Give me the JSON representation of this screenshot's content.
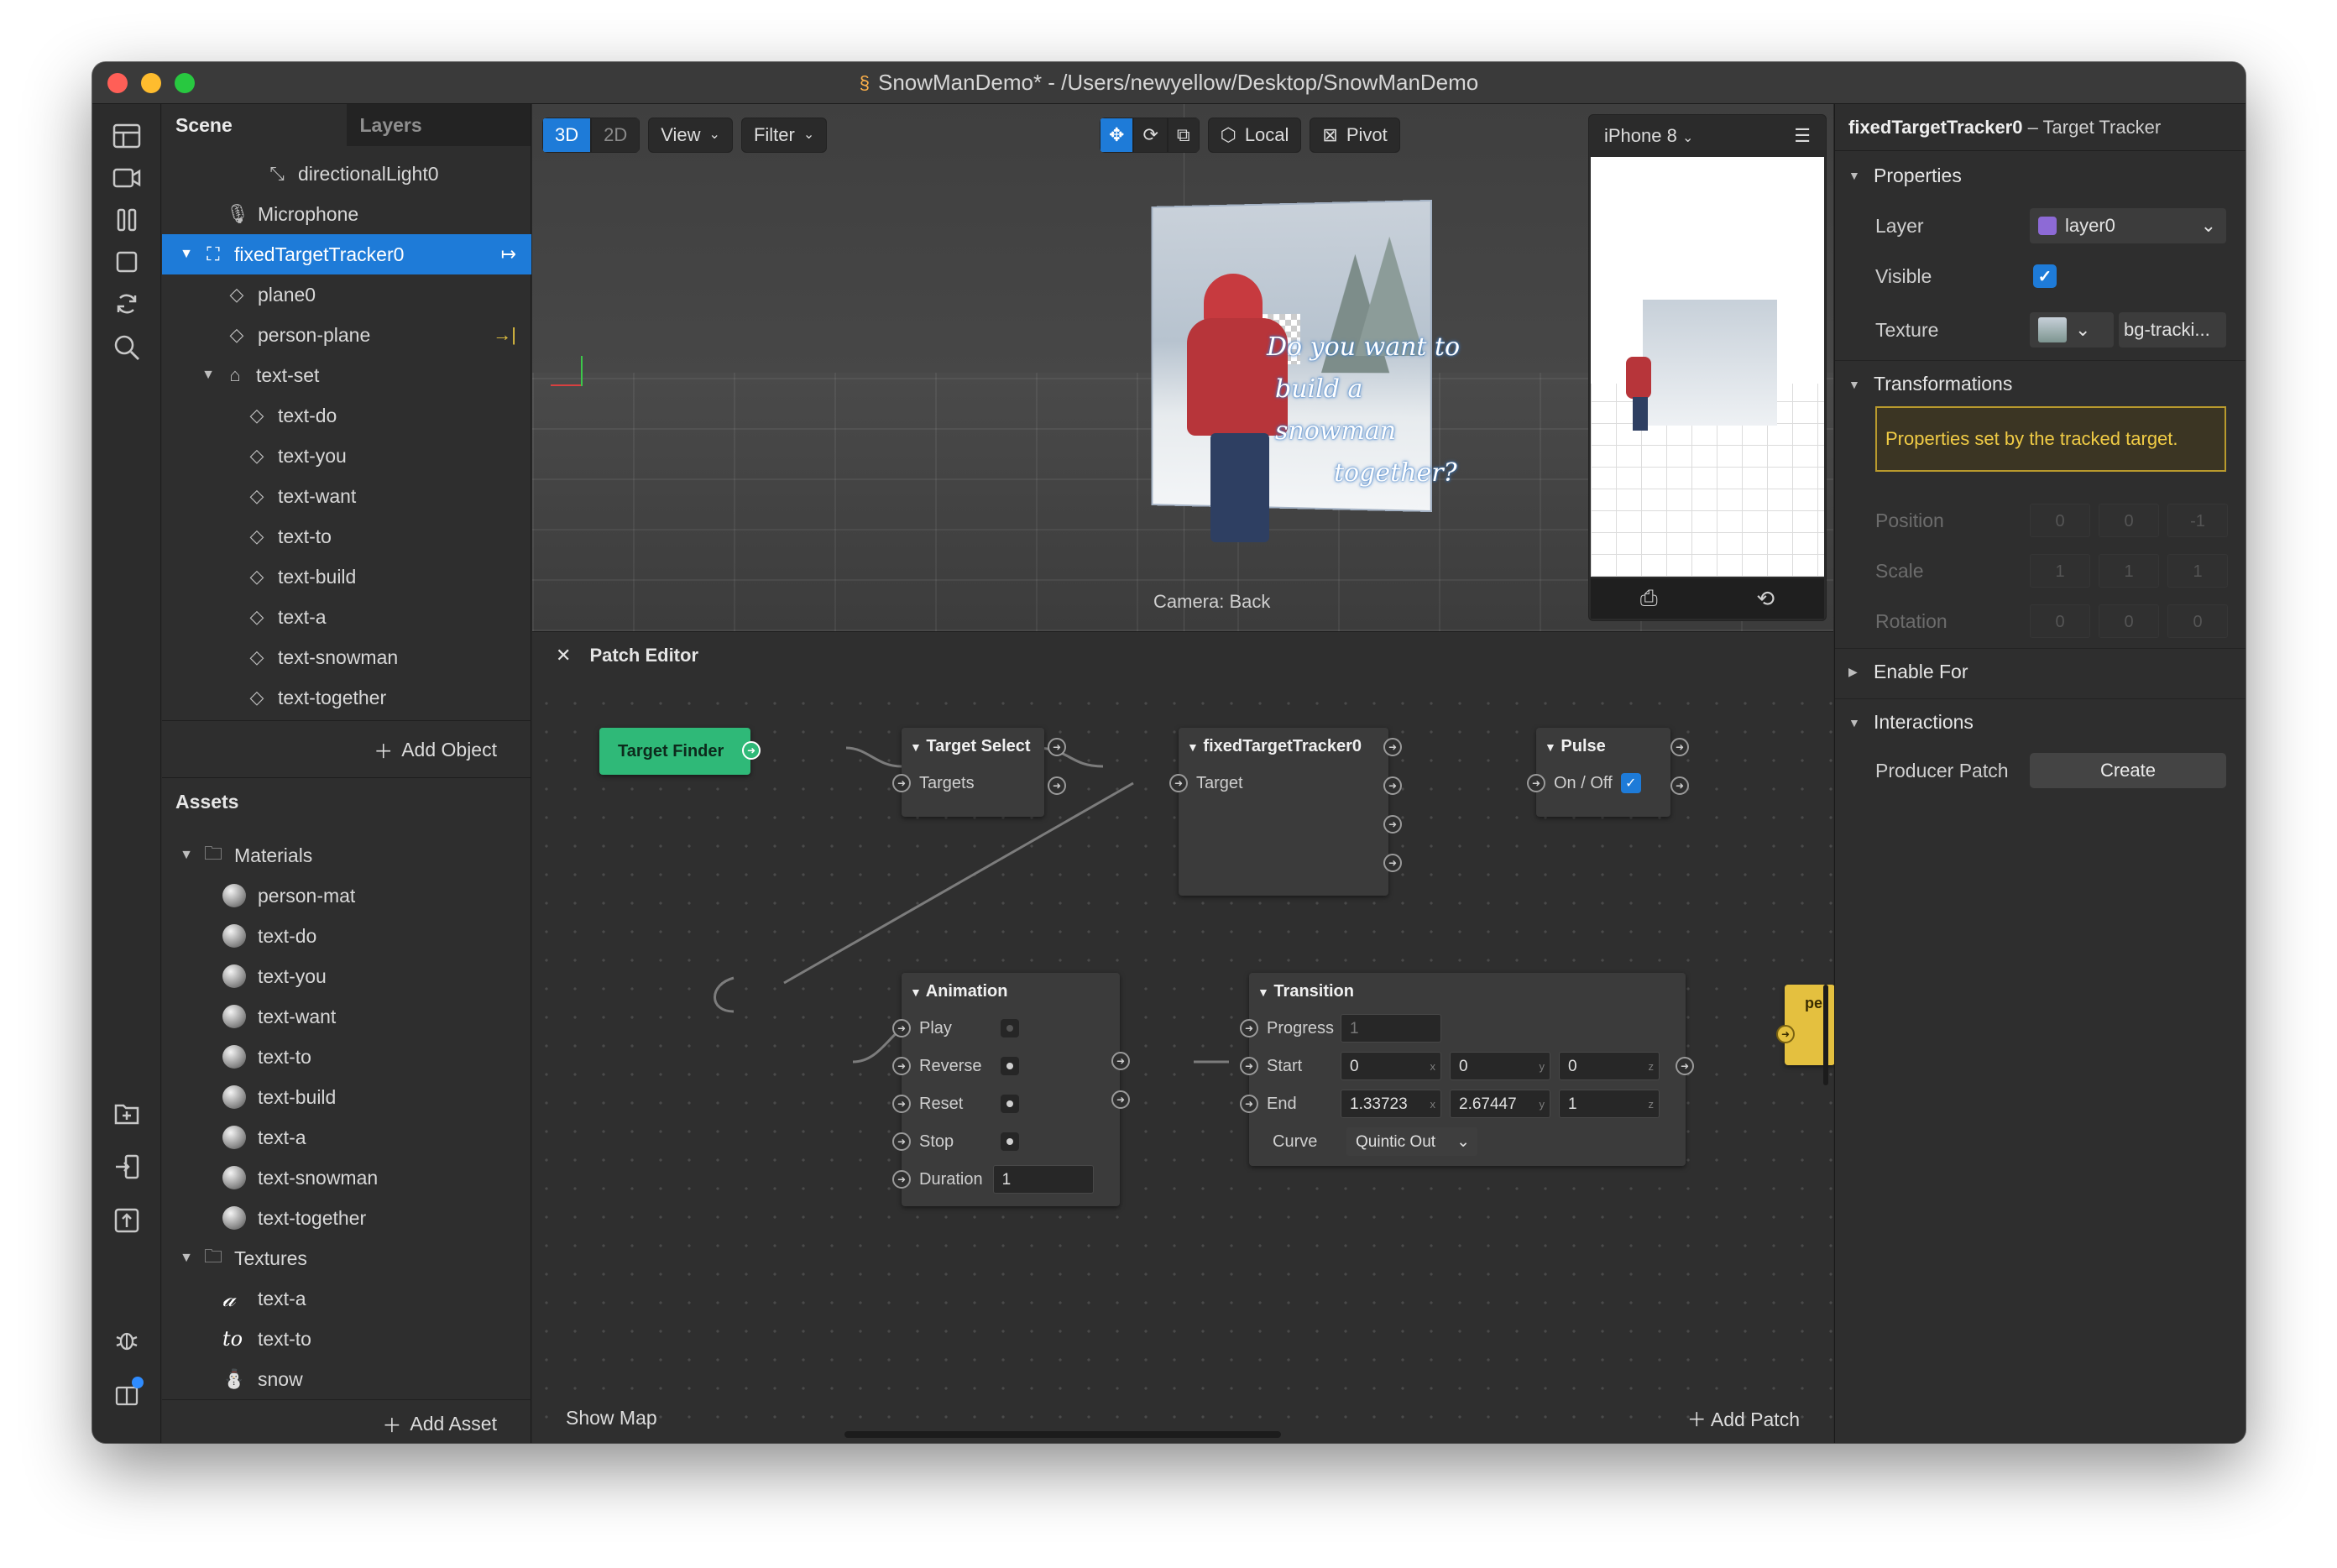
{
  "window": {
    "title": "SnowManDemo* - /Users/newyellow/Desktop/SnowManDemo"
  },
  "rail_icons": [
    "layout-icon",
    "video-icon",
    "pause-bars-icon",
    "square-icon",
    "rotate-icon",
    "search-icon",
    "add-folder-icon",
    "import-icon",
    "export-icon",
    "bug-icon",
    "book-icon"
  ],
  "scene": {
    "tabs": [
      "Scene",
      "Layers"
    ],
    "items": [
      {
        "label": "directionalLight0",
        "icon": "light-icon",
        "indent": 2
      },
      {
        "label": "Microphone",
        "icon": "microphone-icon",
        "indent": 1
      },
      {
        "label": "fixedTargetTracker0",
        "icon": "tracker-icon",
        "indent": 0,
        "selected": true,
        "end": "↦"
      },
      {
        "label": "plane0",
        "icon": "plane-icon",
        "indent": 1
      },
      {
        "label": "person-plane",
        "icon": "plane-icon",
        "indent": 1,
        "end": "→|"
      },
      {
        "label": "text-set",
        "icon": "null-object-icon",
        "indent": 1,
        "expanded": true
      },
      {
        "label": "text-do",
        "icon": "plane-icon",
        "indent": 2
      },
      {
        "label": "text-you",
        "icon": "plane-icon",
        "indent": 2
      },
      {
        "label": "text-want",
        "icon": "plane-icon",
        "indent": 2
      },
      {
        "label": "text-to",
        "icon": "plane-icon",
        "indent": 2
      },
      {
        "label": "text-build",
        "icon": "plane-icon",
        "indent": 2
      },
      {
        "label": "text-a",
        "icon": "plane-icon",
        "indent": 2
      },
      {
        "label": "text-snowman",
        "icon": "plane-icon",
        "indent": 2
      },
      {
        "label": "text-together",
        "icon": "plane-icon",
        "indent": 2
      }
    ],
    "add_object": "Add Object"
  },
  "assets": {
    "title": "Assets",
    "materials_label": "Materials",
    "materials": [
      "person-mat",
      "text-do",
      "text-you",
      "text-want",
      "text-to",
      "text-build",
      "text-a",
      "text-snowman",
      "text-together"
    ],
    "textures_label": "Textures",
    "textures": [
      {
        "label": "text-a",
        "glyph": "𝒶"
      },
      {
        "label": "text-to",
        "glyph": "to"
      },
      {
        "label": "snow",
        "glyph": "⛄"
      }
    ],
    "add_asset": "Add Asset"
  },
  "viewport": {
    "mode_3d": "3D",
    "mode_2d": "2D",
    "view_label": "View",
    "filter_label": "Filter",
    "local_label": "Local",
    "pivot_label": "Pivot",
    "camera_label": "Camera: Back",
    "device": "iPhone 8",
    "overlay_text": [
      "Do you want to",
      "build a snowman",
      "together?"
    ]
  },
  "patch_editor": {
    "title": "Patch Editor",
    "show_map": "Show Map",
    "add_patch": "Add Patch",
    "nodes": {
      "target_finder": "Target Finder",
      "target_select": {
        "title": "Target Select",
        "input": "Targets"
      },
      "tracker": {
        "title": "fixedTargetTracker0",
        "input": "Target"
      },
      "pulse": {
        "title": "Pulse",
        "input": "On / Off"
      },
      "animation": {
        "title": "Animation",
        "inputs": [
          "Play",
          "Reverse",
          "Reset",
          "Stop",
          "Duration"
        ],
        "duration": "1"
      },
      "transition": {
        "title": "Transition",
        "progress_label": "Progress",
        "progress": "1",
        "start_label": "Start",
        "start": [
          "0",
          "0",
          "0"
        ],
        "end_label": "End",
        "end": [
          "1.33723",
          "2.67447",
          "1"
        ],
        "curve_label": "Curve",
        "curve": "Quintic Out",
        "axes": [
          "x",
          "y",
          "z"
        ]
      },
      "partial_node": "pe"
    }
  },
  "inspector": {
    "object_name": "fixedTargetTracker0",
    "object_type": "– Target Tracker",
    "properties_label": "Properties",
    "layer_label": "Layer",
    "layer_value": "layer0",
    "visible_label": "Visible",
    "texture_label": "Texture",
    "texture_value": "bg-tracki...",
    "transformations_label": "Transformations",
    "note": "Properties set by the tracked target.",
    "position_label": "Position",
    "position": [
      "0",
      "0",
      "-1"
    ],
    "scale_label": "Scale",
    "scale": [
      "1",
      "1",
      "1"
    ],
    "rotation_label": "Rotation",
    "rotation": [
      "0",
      "0",
      "0"
    ],
    "enable_for_label": "Enable For",
    "interactions_label": "Interactions",
    "producer_patch_label": "Producer Patch",
    "create_label": "Create"
  }
}
